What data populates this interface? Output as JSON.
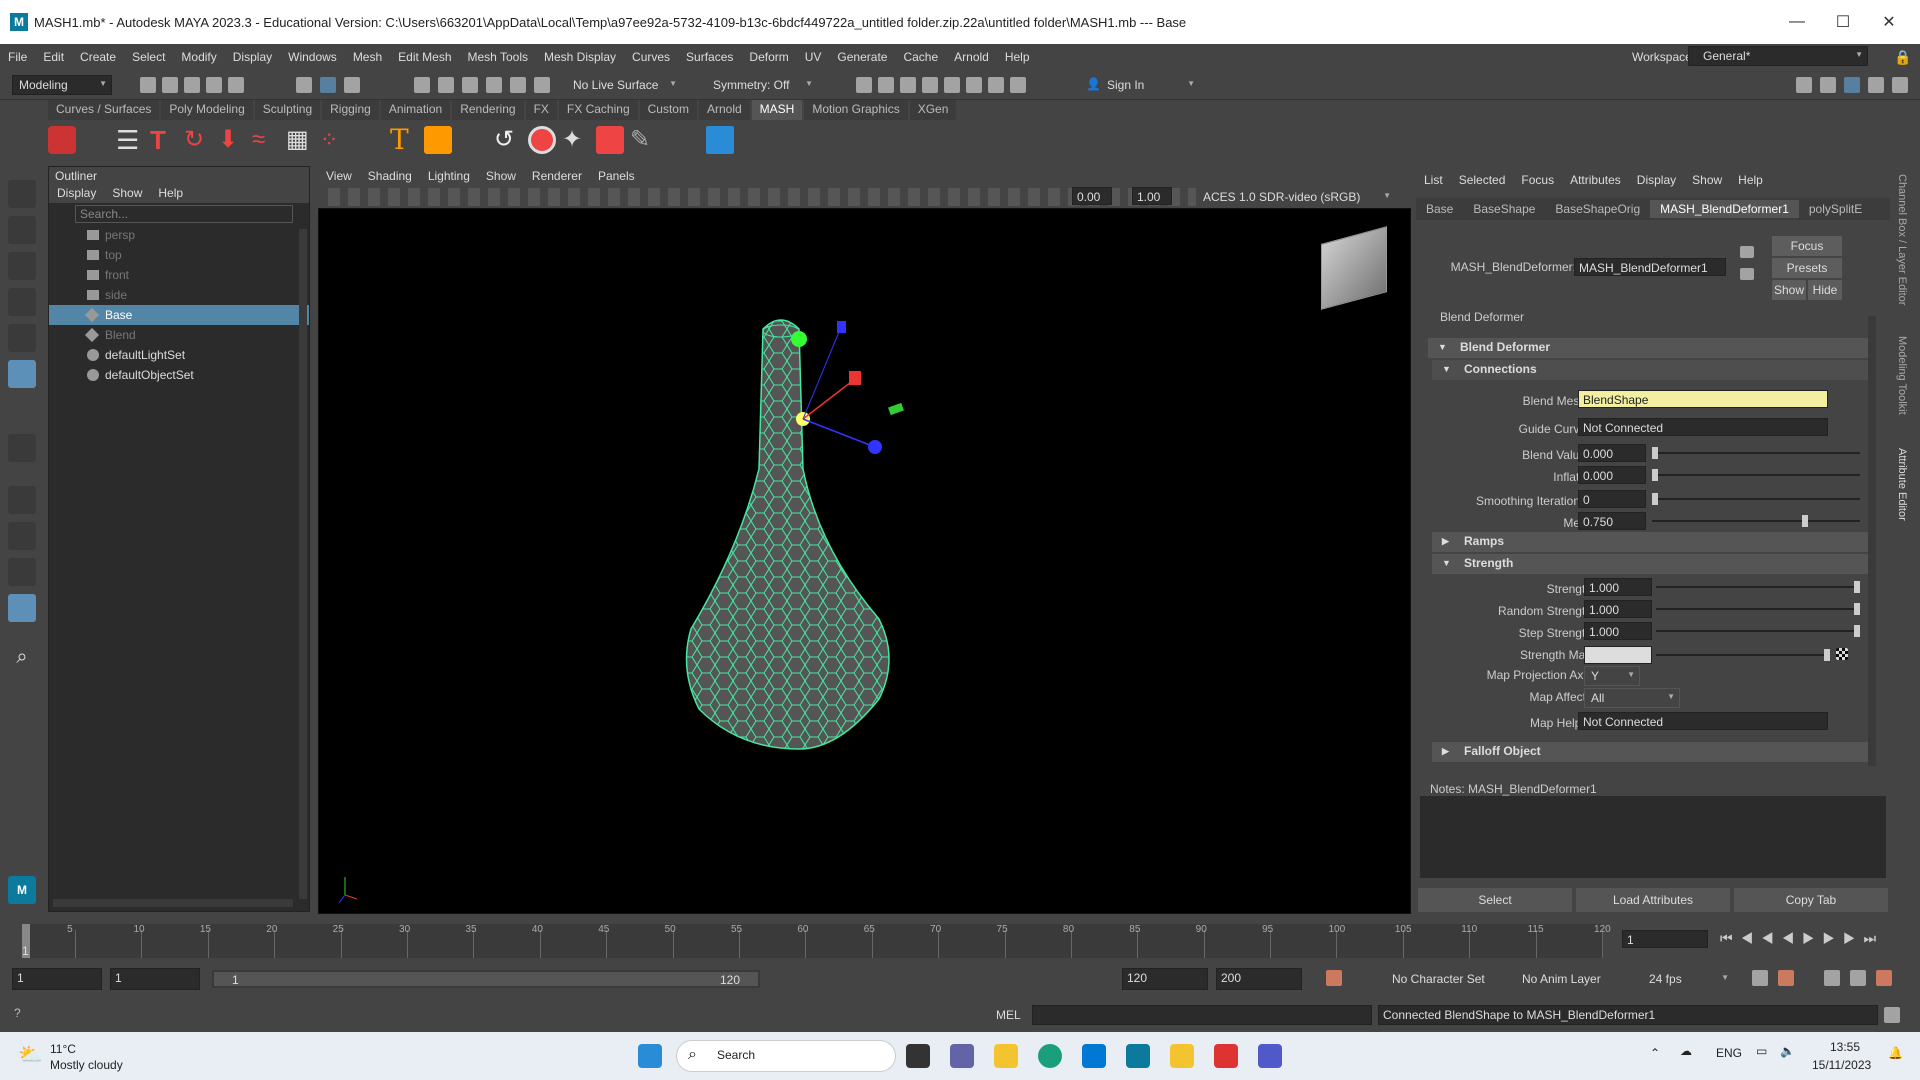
{
  "window": {
    "title": "MASH1.mb* - Autodesk MAYA 2023.3 - Educational Version: C:\\Users\\663201\\AppData\\Local\\Temp\\a97ee92a-5732-4109-b13c-6bdcf449722a_untitled folder.zip.22a\\untitled folder\\MASH1.mb  ---  Base",
    "logo": "M"
  },
  "menubar": [
    "File",
    "Edit",
    "Create",
    "Select",
    "Modify",
    "Display",
    "Windows",
    "Mesh",
    "Edit Mesh",
    "Mesh Tools",
    "Mesh Display",
    "Curves",
    "Surfaces",
    "Deform",
    "UV",
    "Generate",
    "Cache",
    "Arnold",
    "Help"
  ],
  "workspace": {
    "label": "Workspace:",
    "value": "General*"
  },
  "toolbar": {
    "mode": "Modeling",
    "live_surface": "No Live Surface",
    "symmetry": "Symmetry: Off",
    "sign_in": "Sign In"
  },
  "shelf_tabs": [
    "Curves / Surfaces",
    "Poly Modeling",
    "Sculpting",
    "Rigging",
    "Animation",
    "Rendering",
    "FX",
    "FX Caching",
    "Custom",
    "Arnold",
    "MASH",
    "Motion Graphics",
    "XGen"
  ],
  "shelf_active": "MASH",
  "outliner": {
    "title": "Outliner",
    "menu": [
      "Display",
      "Show",
      "Help"
    ],
    "search_placeholder": "Search...",
    "items": [
      {
        "label": "persp",
        "dim": true
      },
      {
        "label": "top",
        "dim": true
      },
      {
        "label": "front",
        "dim": true
      },
      {
        "label": "side",
        "dim": true
      },
      {
        "label": "Base",
        "sel": true
      },
      {
        "label": "Blend",
        "dim": true
      },
      {
        "label": "defaultLightSet"
      },
      {
        "label": "defaultObjectSet"
      }
    ]
  },
  "viewport": {
    "menu": [
      "View",
      "Shading",
      "Lighting",
      "Show",
      "Renderer",
      "Panels"
    ],
    "exposure": "0.00",
    "gamma": "1.00",
    "color_space": "ACES 1.0 SDR-video (sRGB)"
  },
  "attr": {
    "menu": [
      "List",
      "Selected",
      "Focus",
      "Attributes",
      "Display",
      "Show",
      "Help"
    ],
    "tabs": [
      "Base",
      "BaseShape",
      "BaseShapeOrig",
      "MASH_BlendDeformer1",
      "polySplitE"
    ],
    "active_tab": "MASH_BlendDeformer1",
    "node_label": "MASH_BlendDeformer:",
    "node_value": "MASH_BlendDeformer1",
    "focus": "Focus",
    "presets": "Presets",
    "show": "Show",
    "hide": "Hide",
    "header": "Blend Deformer",
    "sec_blend": "Blend Deformer",
    "sec_connections": "Connections",
    "blend_mesh_label": "Blend Mesh",
    "blend_mesh": "BlendShape",
    "guide_curve_label": "Guide Curve",
    "guide_curve": "Not Connected",
    "blend_value_label": "Blend Value",
    "blend_value": "0.000",
    "inflate_label": "Inflate",
    "inflate": "0.000",
    "smoothing_label": "Smoothing Iterations",
    "smoothing": "0",
    "melt_label": "Melt",
    "melt": "0.750",
    "sec_ramps": "Ramps",
    "sec_strength": "Strength",
    "strength_label": "Strength",
    "strength": "1.000",
    "random_strength_label": "Random Strength",
    "random_strength": "1.000",
    "step_strength_label": "Step Strength",
    "step_strength": "1.000",
    "strength_map_label": "Strength Map",
    "map_axis_label": "Map Projection Axis",
    "map_axis": "Y",
    "map_affects_label": "Map Affects",
    "map_affects": "All",
    "map_helper_label": "Map Helper",
    "map_helper": "Not Connected",
    "sec_falloff": "Falloff Object",
    "notes": "Notes:  MASH_BlendDeformer1",
    "btn_select": "Select",
    "btn_load": "Load Attributes",
    "btn_copy": "Copy Tab"
  },
  "side_tabs": [
    "Channel Box / Layer Editor",
    "Modeling Toolkit",
    "Attribute Editor"
  ],
  "timeline": {
    "ticks": [
      "5",
      "10",
      "15",
      "20",
      "25",
      "30",
      "35",
      "40",
      "45",
      "50",
      "55",
      "60",
      "65",
      "70",
      "75",
      "80",
      "85",
      "90",
      "95",
      "100",
      "105",
      "110",
      "115",
      "120"
    ],
    "current": "1",
    "current_field": "1"
  },
  "range": {
    "start": "1",
    "start2": "1",
    "slider_start": "1",
    "slider_end": "120",
    "end": "120",
    "end2": "200",
    "char_set": "No Character Set",
    "anim_layer": "No Anim Layer",
    "fps": "24 fps"
  },
  "cmd": {
    "lang": "MEL",
    "result": "Connected BlendShape to MASH_BlendDeformer1"
  },
  "taskbar": {
    "temp": "11°C",
    "weather": "Mostly cloudy",
    "search": "Search",
    "lang": "ENG",
    "time": "13:55",
    "date": "15/11/2023"
  }
}
